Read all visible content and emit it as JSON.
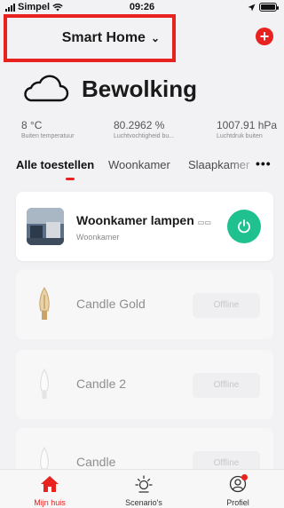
{
  "status_bar": {
    "carrier": "Simpel",
    "time": "09:26"
  },
  "header": {
    "home_name": "Smart Home",
    "add_icon": "plus-icon"
  },
  "weather": {
    "condition": "Bewolking",
    "icon": "cloud-icon",
    "metrics": [
      {
        "value": "8 °C",
        "label": "Buiten temperatuur"
      },
      {
        "value": "80.2962 %",
        "label": "Luchtvochtigheid bu..."
      },
      {
        "value": "1007.91 hPa",
        "label": "Luchtdruk buiten"
      }
    ]
  },
  "tabs": {
    "items": [
      "Alle toestellen",
      "Woonkamer",
      "Slaapkamer"
    ],
    "active": "Alle toestellen",
    "more_label": "•••"
  },
  "devices": [
    {
      "name": "Woonkamer lampen",
      "room": "Woonkamer",
      "status": "online",
      "icon": "power-icon"
    },
    {
      "name": "Candle Gold",
      "room": "",
      "status": "Offline",
      "icon": "gold-bulb-icon"
    },
    {
      "name": "Candle 2",
      "room": "",
      "status": "Offline",
      "icon": "white-bulb-icon"
    },
    {
      "name": "Candle",
      "room": "",
      "status": "Offline",
      "icon": "white-bulb-icon"
    }
  ],
  "bottom_nav": [
    {
      "label": "Mijn huis",
      "icon": "house-icon",
      "active": true
    },
    {
      "label": "Scenario's",
      "icon": "sun-icon",
      "active": false
    },
    {
      "label": "Profiel",
      "icon": "profile-icon",
      "active": false
    }
  ],
  "colors": {
    "accent": "#e8231f",
    "power_green": "#1fc28f",
    "background": "#f2f2f4"
  }
}
